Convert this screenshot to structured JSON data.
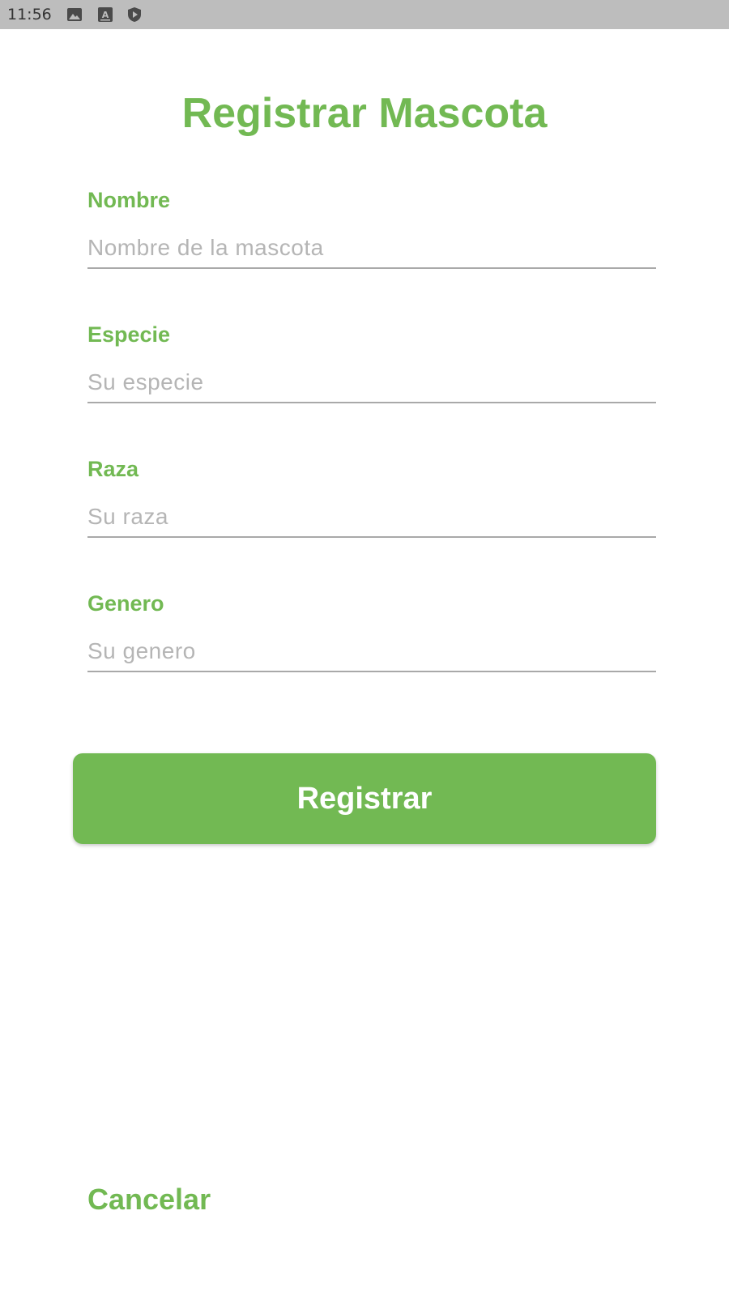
{
  "status_bar": {
    "time": "11:56",
    "icons": [
      "image-icon",
      "keyboard-a-icon",
      "shield-play-icon"
    ]
  },
  "title": "Registrar Mascota",
  "form": {
    "fields": [
      {
        "label": "Nombre",
        "placeholder": "Nombre de la mascota",
        "value": ""
      },
      {
        "label": "Especie",
        "placeholder": "Su especie",
        "value": ""
      },
      {
        "label": "Raza",
        "placeholder": "Su raza",
        "value": ""
      },
      {
        "label": "Genero",
        "placeholder": "Su genero",
        "value": ""
      }
    ]
  },
  "actions": {
    "register_label": "Registrar",
    "cancel_label": "Cancelar"
  },
  "colors": {
    "accent": "#72b953",
    "status_bar": "#bdbdbd",
    "underline": "#a9a9a9",
    "placeholder": "#b5b5b5"
  }
}
